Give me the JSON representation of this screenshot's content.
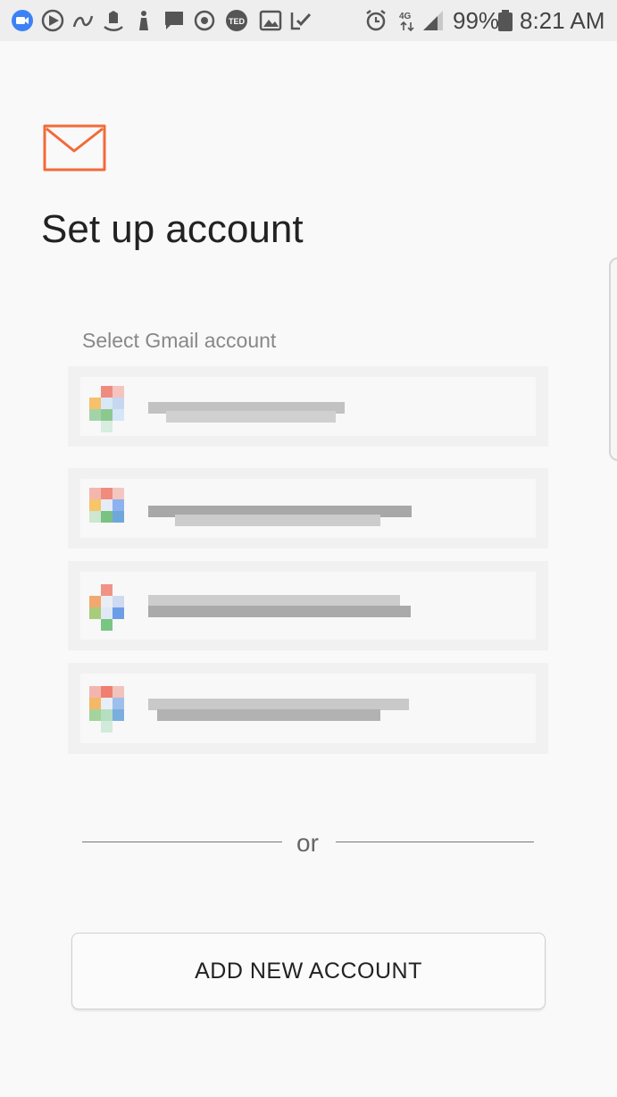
{
  "status_bar": {
    "battery_percent": "99%",
    "time": "8:21 AM",
    "network": "4G",
    "icons": [
      "duo-icon",
      "circle-play-icon",
      "alexa-icon",
      "amazon-icon",
      "hand-icon",
      "message-icon",
      "refresh-icon",
      "ted-icon",
      "image-icon",
      "checklist-icon",
      "alarm-icon",
      "signal-icon",
      "battery-icon"
    ]
  },
  "header": {
    "logo": "mail-icon",
    "title": "Set up account",
    "accent_color": "#f26a3a"
  },
  "accounts": {
    "label": "Select Gmail account",
    "items": [
      {
        "email": ""
      },
      {
        "email": ""
      },
      {
        "email": ""
      },
      {
        "email": ""
      }
    ]
  },
  "divider": {
    "text": "or"
  },
  "actions": {
    "add_new_account": "ADD NEW ACCOUNT"
  }
}
